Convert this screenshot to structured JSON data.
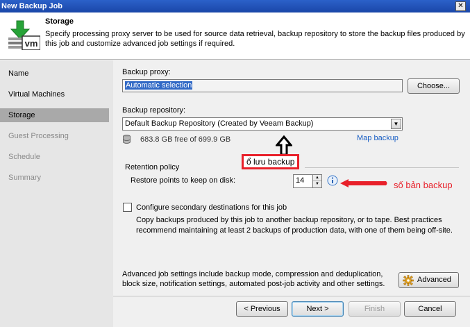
{
  "window": {
    "title": "New Backup Job",
    "close_glyph": "✕"
  },
  "header": {
    "title": "Storage",
    "description": "Specify processing proxy server to be used for source data retrieval, backup repository to store the backup files produced by this job and customize advanced job settings if required.",
    "icon_label": "vm"
  },
  "nav": {
    "items": [
      {
        "label": "Name",
        "state": "normal"
      },
      {
        "label": "Virtual Machines",
        "state": "normal"
      },
      {
        "label": "Storage",
        "state": "active"
      },
      {
        "label": "Guest Processing",
        "state": "disabled"
      },
      {
        "label": "Schedule",
        "state": "disabled"
      },
      {
        "label": "Summary",
        "state": "disabled"
      }
    ]
  },
  "proxy": {
    "label": "Backup proxy:",
    "value": "Automatic selection",
    "choose_label": "Choose..."
  },
  "repository": {
    "label": "Backup repository:",
    "value": "Default Backup Repository (Created by Veeam Backup)",
    "free_space": "683.8 GB free of 699.9 GB",
    "map_link": "Map backup"
  },
  "annotations": {
    "storage_note": "ổ lưu backup",
    "points_note": "số bản backup",
    "color": "#e8202a"
  },
  "retention": {
    "group_label": "Retention policy",
    "restore_label": "Restore points to keep on disk:",
    "restore_value": "14"
  },
  "secondary": {
    "checkbox_label": "Configure secondary destinations for this job",
    "description": "Copy backups produced by this job to another backup repository, or to tape. Best practices recommend maintaining at least 2 backups of production data, with one of them being off-site."
  },
  "advanced": {
    "description": "Advanced job settings include backup mode, compression and deduplication, block size, notification settings, automated post-job activity and other settings.",
    "button_label": "Advanced"
  },
  "footer": {
    "previous_label": "< Previous",
    "next_label": "Next >",
    "finish_label": "Finish",
    "cancel_label": "Cancel"
  }
}
